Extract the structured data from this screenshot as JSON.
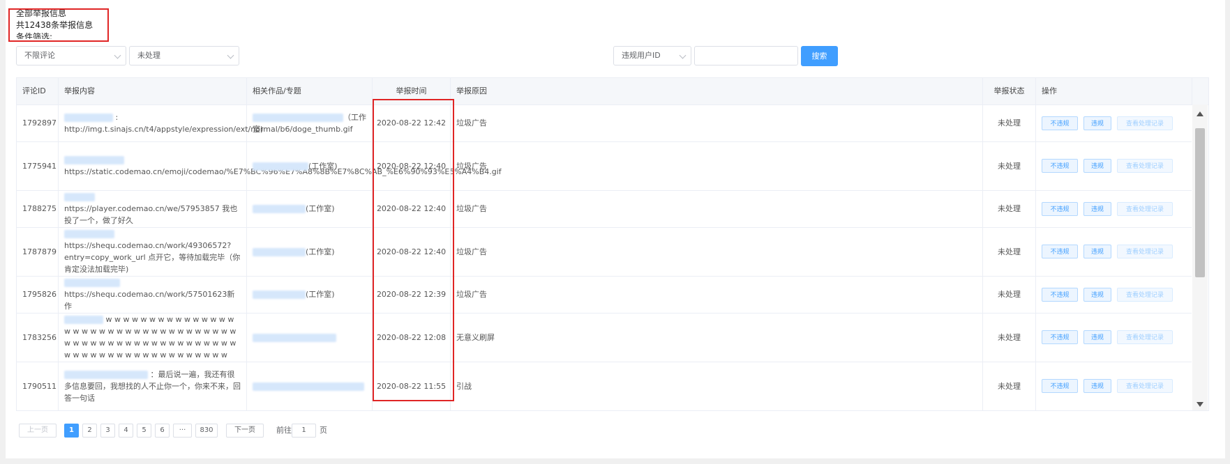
{
  "header": {
    "title": "全部举报信息",
    "total_text": "共12438条举报信息",
    "filter_label": "条件筛选:"
  },
  "filters": {
    "comment_scope": "不限评论",
    "status": "未处理",
    "id_type": "违规用户ID",
    "search_value": "",
    "search_button": "搜索"
  },
  "table": {
    "columns": [
      "评论ID",
      "举报内容",
      "相关作品/专题",
      "举报时间",
      "举报原因",
      "举报状态",
      "操作"
    ],
    "actions": {
      "not_violation": "不违规",
      "violation": "违规",
      "view_records": "查看处理记录"
    },
    "rows": [
      {
        "id": "1792897",
        "content": ": http://img.t.sinajs.cn/t4/appstyle/expression/ext/normal/b6/doge_thumb.gif",
        "related_suffix": "（工作室)",
        "time": "2020-08-22 12:42",
        "reason": "垃圾广告",
        "status": "未处理"
      },
      {
        "id": "1775941",
        "content": "https://static.codemao.cn/emoji/codemao/%E7%BC%96%E7%A8%8B%E7%8C%AB_%E6%90%93%E5%A4%B4.gif",
        "related_suffix": "(工作室)",
        "time": "2020-08-22 12:40",
        "reason": "垃圾广告",
        "status": "未处理"
      },
      {
        "id": "1788275",
        "content": "nttps://player.codemao.cn/we/57953857 我也投了一个，做了好久",
        "related_suffix": "(工作室)",
        "time": "2020-08-22 12:40",
        "reason": "垃圾广告",
        "status": "未处理"
      },
      {
        "id": "1787879",
        "content": "https://shequ.codemao.cn/work/49306572?entry=copy_work_url 点开它，等待加载完毕（你肯定没法加载完毕)",
        "related_suffix": "(工作室)",
        "time": "2020-08-22 12:40",
        "reason": "垃圾广告",
        "status": "未处理"
      },
      {
        "id": "1795826",
        "content": "https://shequ.codemao.cn/work/57501623新作",
        "related_suffix": "(工作室)",
        "time": "2020-08-22 12:39",
        "reason": "垃圾广告",
        "status": "未处理"
      },
      {
        "id": "1783256",
        "content": "w w w w w w w w w w w w w w w w w w w w w w w w w w w w w w w w w w w w w w w w w w w w w w w w w w w w w w w w w w w w w w w w w w w w w w w w w w",
        "related_suffix": "",
        "time": "2020-08-22 12:08",
        "reason": "无意义刷屏",
        "status": "未处理"
      },
      {
        "id": "1790511",
        "content": "：最后说一遍，我还有很多信息要回，我想找的人不止你一个，你来不来，回答一句话",
        "related_suffix": "",
        "time": "2020-08-22 11:55",
        "reason": "引战",
        "status": "未处理"
      }
    ]
  },
  "pagination": {
    "prev": "上一页",
    "pages": [
      "1",
      "2",
      "3",
      "4",
      "5",
      "6",
      "···",
      "830"
    ],
    "next": "下一页",
    "goto_label": "前往",
    "goto_value": "1",
    "page_unit": "页"
  },
  "colors": {
    "primary": "#409eff",
    "highlight": "#e02525"
  }
}
